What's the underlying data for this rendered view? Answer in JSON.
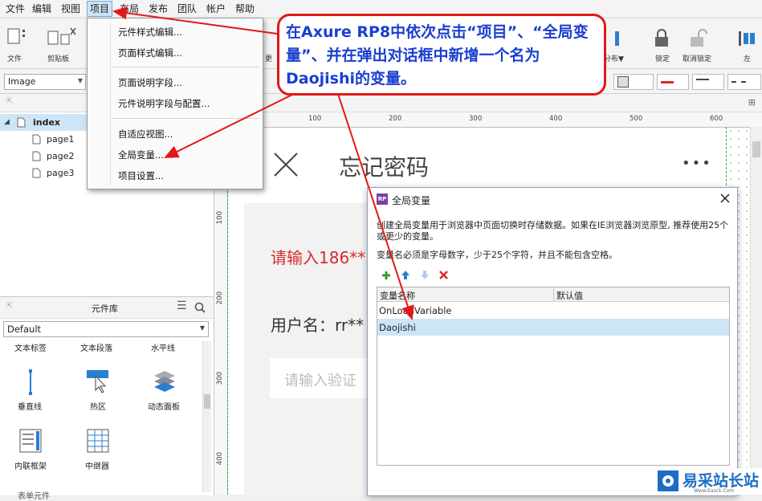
{
  "menubar": {
    "items": [
      "文件",
      "编辑",
      "视图",
      "项目",
      "布局",
      "发布",
      "团队",
      "帐户",
      "帮助"
    ],
    "active": "项目"
  },
  "toolbar": {
    "file_label": "文件",
    "clipboard_label": "剪贴板",
    "more_label": "更",
    "distribute_label": "分布▼",
    "lock_label": "锁定",
    "unlock_label": "取消锁定",
    "left_label": "左"
  },
  "toolbar2": {
    "widget_type": "Image"
  },
  "project_menu": {
    "items": [
      "元件样式编辑...",
      "页面样式编辑...",
      "页面说明字段...",
      "元件说明字段与配置...",
      "自适应视图...",
      "全局变量...",
      "项目设置..."
    ]
  },
  "pages": {
    "root": "index",
    "children": [
      "page1",
      "page2",
      "page3"
    ]
  },
  "library": {
    "title": "元件库",
    "selected": "Default",
    "top_labels": [
      "文本标签",
      "文本段落",
      "水平线"
    ],
    "widgets": [
      "垂直线",
      "热区",
      "动态面板",
      "内联框架",
      "中继器"
    ],
    "bottom_label": "表单元件"
  },
  "rulers": {
    "h_ticks": [
      "100",
      "200",
      "300",
      "400",
      "500",
      "600"
    ],
    "v_ticks": [
      "100",
      "200",
      "300",
      "400"
    ]
  },
  "canvas": {
    "title": "忘记密码",
    "more": "•••",
    "prompt_text": "请输入186**",
    "username_text": "用户名：rr**",
    "code_placeholder": "请输入验证"
  },
  "dialog": {
    "title": "全局变量",
    "app_icon": "RP",
    "desc1": "创建全局变量用于浏览器中页面切换时存储数据。如果在IE浏览器浏览原型, 推荐使用25个或更少的变量。",
    "desc2": "变量名必须是字母数字，少于25个字符，并且不能包含空格。",
    "col_name": "变量名称",
    "col_default": "默认值",
    "rows": [
      "OnLoadVariable",
      "Daojishi"
    ],
    "selected_row": 1
  },
  "callout": {
    "text": "在Axure RP8中依次点击“项目”、“全局变量”、并在弹出对话框中新增一个名为Daojishi的变量。"
  },
  "watermark": {
    "text": "易采站长站",
    "url": "Www.Easck.Com"
  },
  "colors": {
    "callout_border": "#e21818",
    "callout_text": "#1a3fd0",
    "selection": "#cde6f7",
    "accent_red": "#d62b2b",
    "add_green": "#3a9a28",
    "move_blue": "#2a7fcf"
  }
}
